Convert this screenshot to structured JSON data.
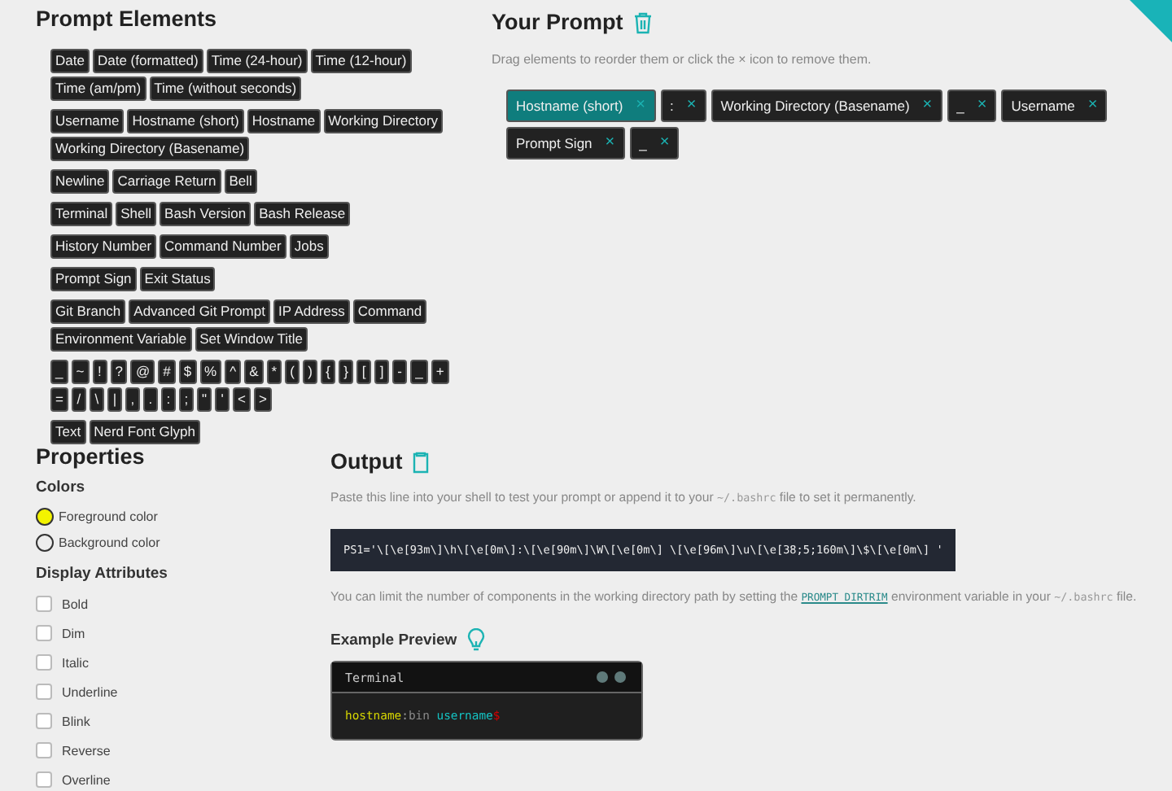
{
  "elements": {
    "title": "Prompt Elements",
    "groups": [
      [
        "Date",
        "Date (formatted)",
        "Time (24-hour)",
        "Time (12-hour)",
        "Time (am/pm)",
        "Time (without seconds)"
      ],
      [
        "Username",
        "Hostname (short)",
        "Hostname",
        "Working Directory",
        "Working Directory (Basename)"
      ],
      [
        "Newline",
        "Carriage Return",
        "Bell"
      ],
      [
        "Terminal",
        "Shell",
        "Bash Version",
        "Bash Release"
      ],
      [
        "History Number",
        "Command Number",
        "Jobs"
      ],
      [
        "Prompt Sign",
        "Exit Status"
      ],
      [
        "Git Branch",
        "Advanced Git Prompt",
        "IP Address",
        "Command",
        "Environment Variable",
        "Set Window Title"
      ],
      [
        "_",
        "~",
        "!",
        "?",
        "@",
        "#",
        "$",
        "%",
        "^",
        "&",
        "*",
        "(",
        ")",
        "{",
        "}",
        "[",
        "]",
        "-",
        "_",
        "+",
        "=",
        "/",
        "\\",
        "|",
        ",",
        ".",
        ":",
        ";",
        "\"",
        "'",
        "<",
        ">"
      ],
      [
        "Text",
        "Nerd Font Glyph"
      ]
    ]
  },
  "your_prompt": {
    "title": "Your Prompt",
    "hint": "Drag elements to reorder them or click the × icon to remove them.",
    "tokens": [
      {
        "label": "Hostname (short)",
        "selected": true
      },
      {
        "label": ":",
        "selected": false
      },
      {
        "label": "Working Directory (Basename)",
        "selected": false
      },
      {
        "label": "_",
        "selected": false
      },
      {
        "label": "Username",
        "selected": false
      },
      {
        "label": "Prompt Sign",
        "selected": false
      },
      {
        "label": "_",
        "selected": false
      }
    ],
    "remove_glyph": "×"
  },
  "properties": {
    "title": "Properties",
    "colors_title": "Colors",
    "colors": [
      {
        "label": "Foreground color",
        "selected": true
      },
      {
        "label": "Background color",
        "selected": false
      }
    ],
    "attributes_title": "Display Attributes",
    "attributes": [
      {
        "label": "Bold",
        "checked": false
      },
      {
        "label": "Dim",
        "checked": false
      },
      {
        "label": "Italic",
        "checked": false
      },
      {
        "label": "Underline",
        "checked": false
      },
      {
        "label": "Blink",
        "checked": false
      },
      {
        "label": "Reverse",
        "checked": false
      },
      {
        "label": "Overline",
        "checked": false
      }
    ]
  },
  "output": {
    "title": "Output",
    "intro": [
      {
        "kind": "text",
        "text": "Paste this line into your shell to test your prompt or append it to your "
      },
      {
        "kind": "code",
        "text": "~/.bashrc"
      },
      {
        "kind": "text",
        "text": " file to set it permanently."
      }
    ],
    "code": "PS1='\\[\\e[93m\\]\\h\\[\\e[0m\\]:\\[\\e[90m\\]\\W\\[\\e[0m\\] \\[\\e[96m\\]\\u\\[\\e[38;5;160m\\]\\$\\[\\e[0m\\] '",
    "note": [
      {
        "kind": "text",
        "text": "You can limit the number of components in the working directory path by setting the "
      },
      {
        "kind": "link",
        "text": "PROMPT_DIRTRIM"
      },
      {
        "kind": "text",
        "text": " environment variable in your "
      },
      {
        "kind": "code",
        "text": "~/.bashrc"
      },
      {
        "kind": "text",
        "text": " file."
      }
    ],
    "preview_title": "Example Preview",
    "terminal": {
      "title": "Terminal",
      "segments": [
        {
          "text": "hostname",
          "color": "#d7d700"
        },
        {
          "text": ":",
          "color": "#9a9a9a"
        },
        {
          "text": "bin",
          "color": "#8a8a8a"
        },
        {
          "text": "username",
          "color": "#14c4c4",
          "spaced": true
        },
        {
          "text": "$",
          "color": "#d70000"
        }
      ]
    }
  }
}
